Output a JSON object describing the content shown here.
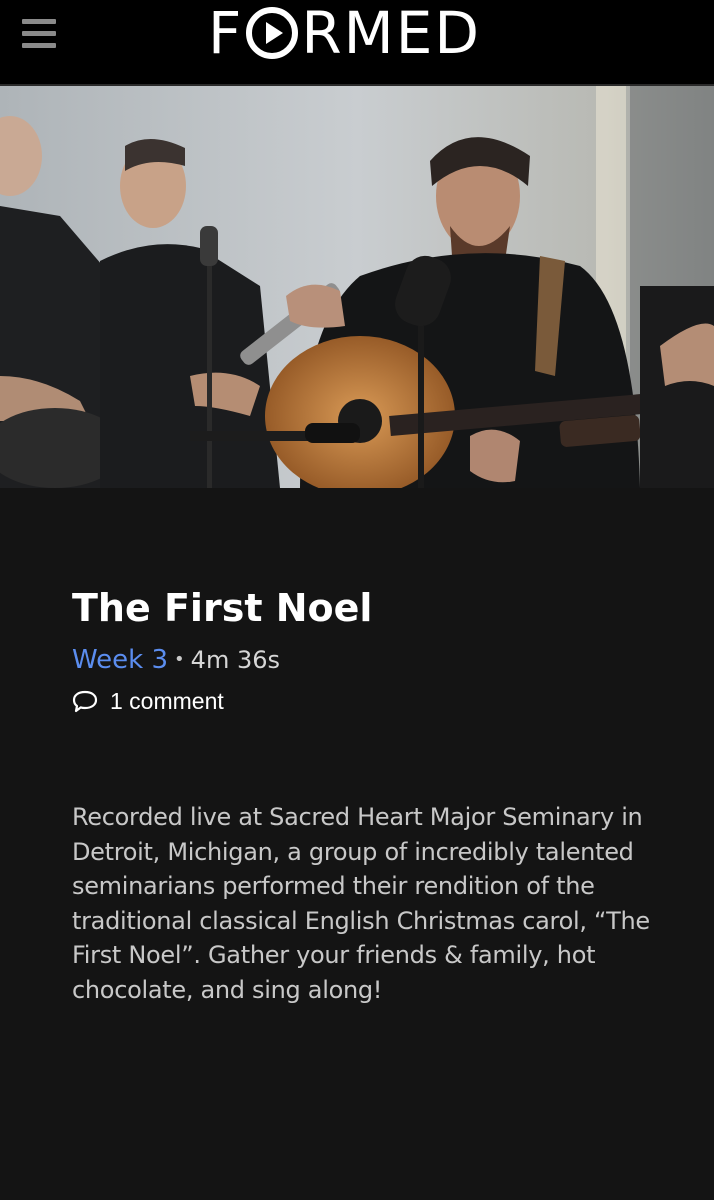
{
  "header": {
    "menu_icon": "hamburger-menu-icon",
    "logo_left": "F",
    "logo_right": "RMED",
    "logo_icon": "play-circle-icon",
    "background": "#000000"
  },
  "video": {
    "title": "The First Noel",
    "week": "Week 3",
    "separator": "•",
    "duration": "4m 36s",
    "comments": "1 comment",
    "comment_icon": "speech-bubble-icon",
    "description": "Recorded live at Sacred Heart Major Seminary in Detroit, Michigan, a group of incredibly talented seminarians performed their rendition of the traditional classical English Christmas carol, “The First Noel”. Gather your friends & family, hot chocolate, and sing along!"
  },
  "colors": {
    "accent": "#5b8def",
    "page_background": "#141414"
  }
}
